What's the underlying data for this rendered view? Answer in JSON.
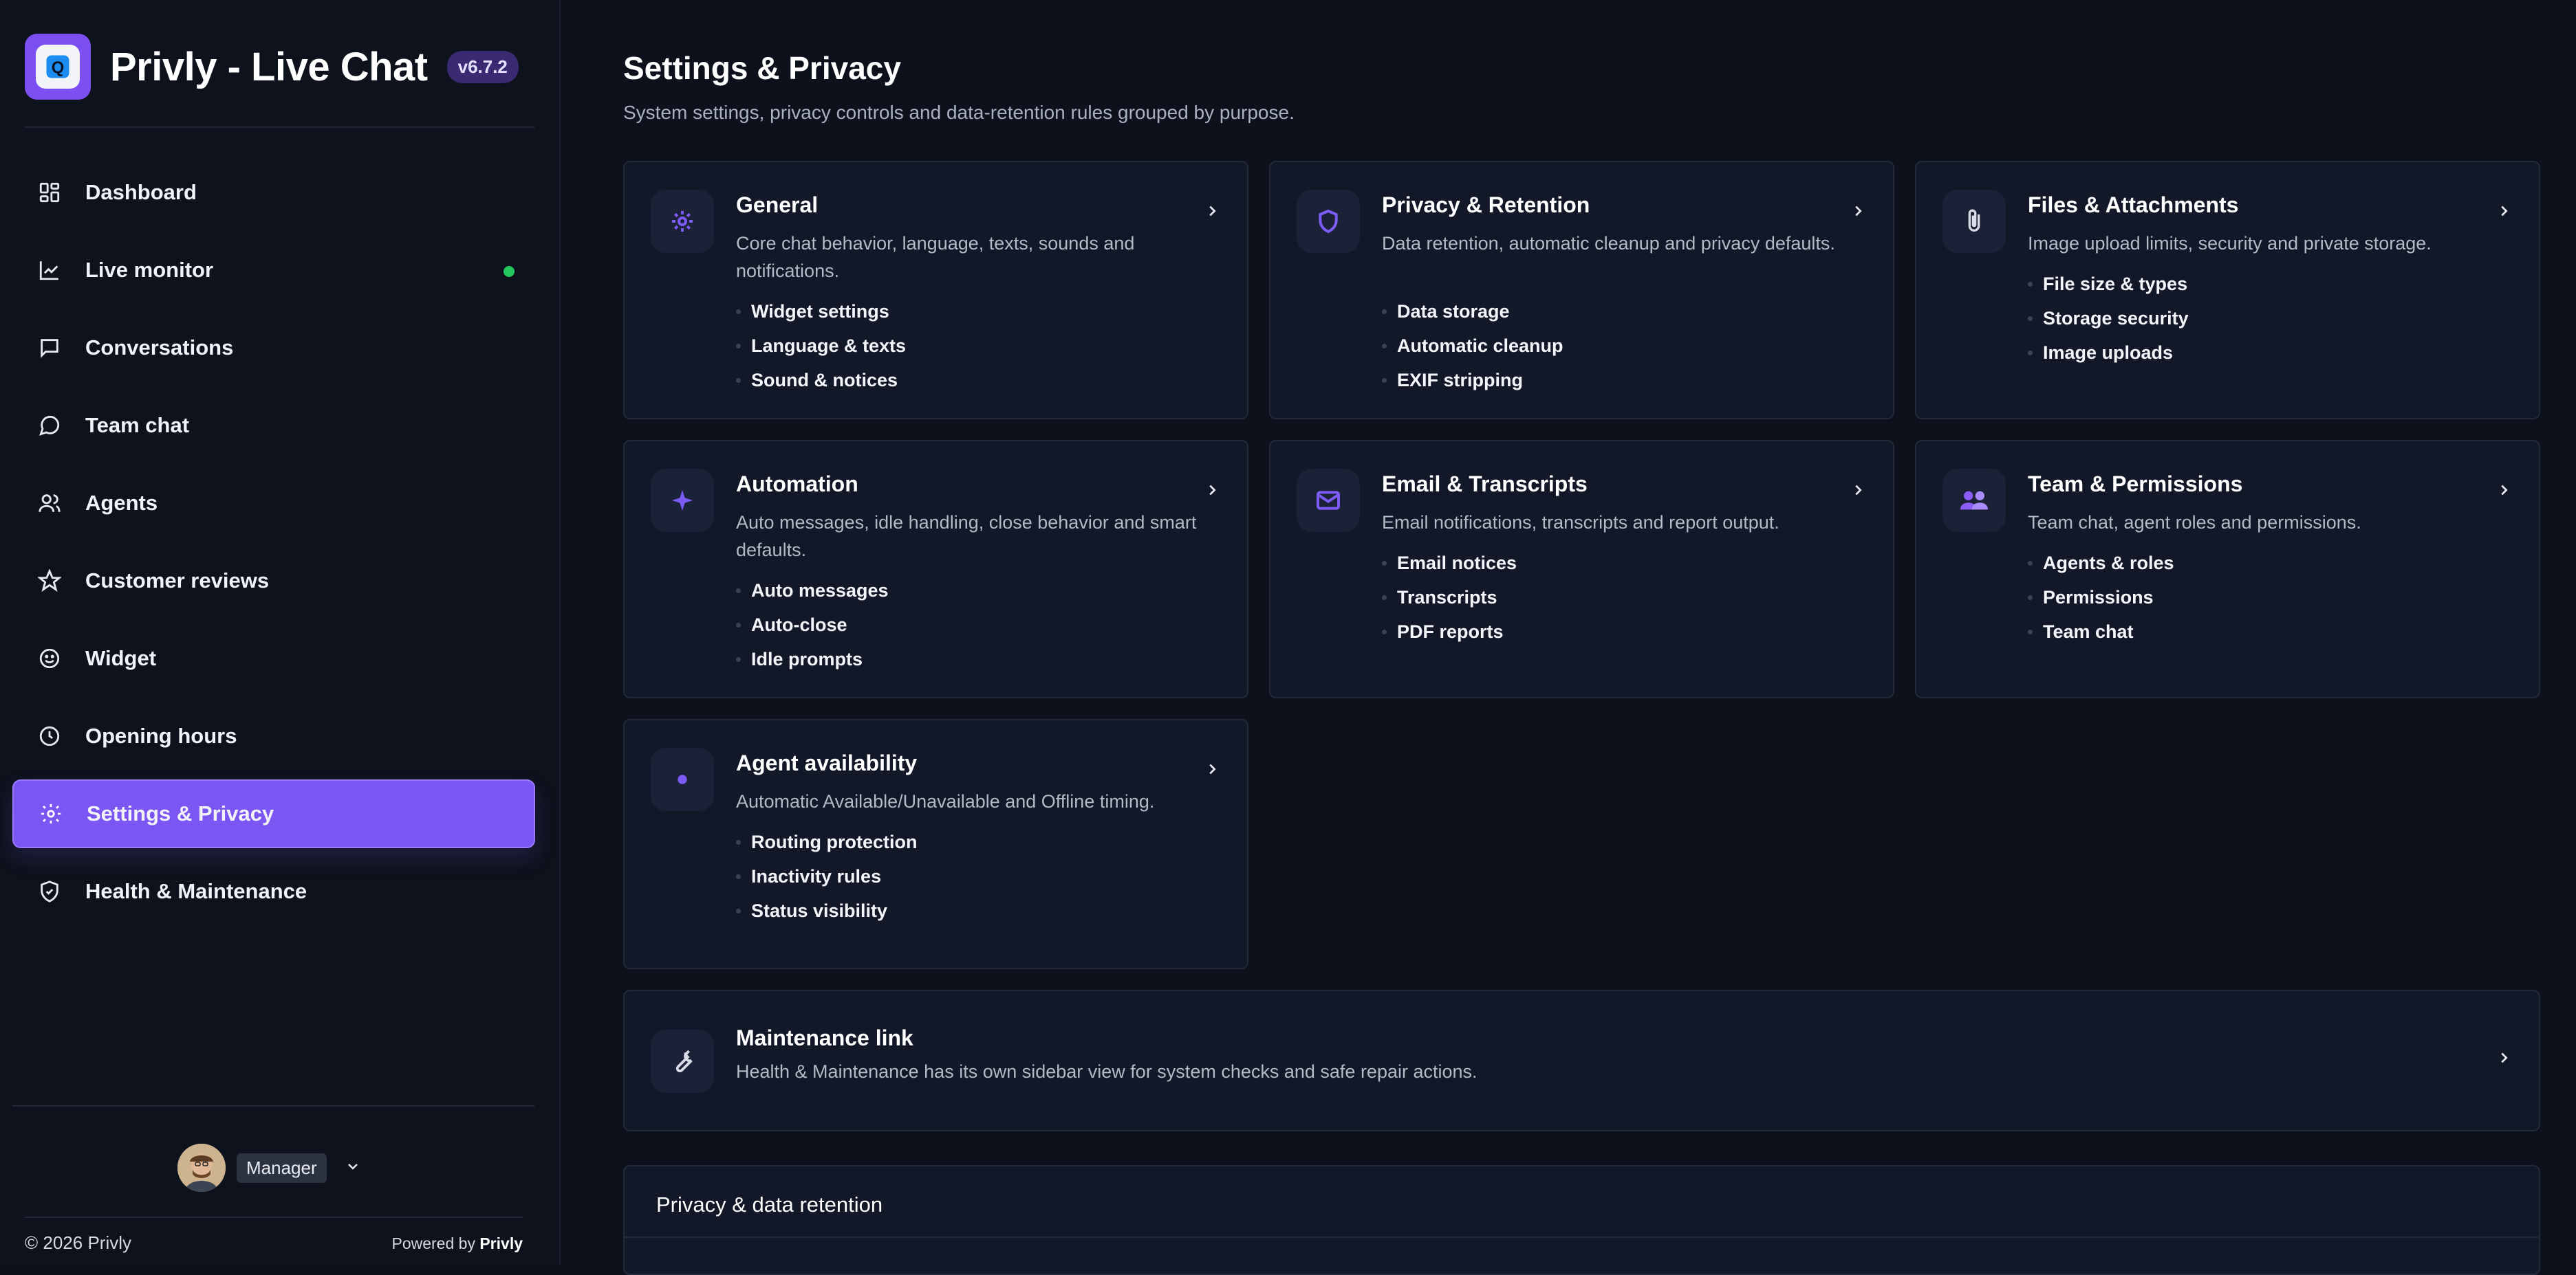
{
  "app": {
    "title": "Privly - Live Chat",
    "version": "v6.7.2"
  },
  "sidebar": {
    "items": [
      {
        "label": "Dashboard",
        "icon": "dashboard-icon"
      },
      {
        "label": "Live monitor",
        "icon": "chart-line-icon",
        "status": "online"
      },
      {
        "label": "Conversations",
        "icon": "chat-bubble-icon"
      },
      {
        "label": "Team chat",
        "icon": "chat-round-icon"
      },
      {
        "label": "Agents",
        "icon": "users-icon"
      },
      {
        "label": "Customer reviews",
        "icon": "star-icon"
      },
      {
        "label": "Widget",
        "icon": "smile-icon"
      },
      {
        "label": "Opening hours",
        "icon": "clock-icon"
      },
      {
        "label": "Settings & Privacy",
        "icon": "gear-icon",
        "active": true
      },
      {
        "label": "Health & Maintenance",
        "icon": "shield-check-icon"
      }
    ],
    "user": {
      "role": "Manager"
    },
    "footer": {
      "copyright": "© 2026 Privly",
      "powered_prefix": "Powered by",
      "powered_brand": "Privly"
    }
  },
  "page": {
    "title": "Settings & Privacy",
    "subtitle": "System settings, privacy controls and data-retention rules grouped by purpose."
  },
  "cards": [
    {
      "title": "General",
      "icon": "gear-icon",
      "desc": "Core chat behavior, language, texts, sounds and notifications.",
      "items": [
        "Widget settings",
        "Language & texts",
        "Sound & notices"
      ]
    },
    {
      "title": "Privacy & Retention",
      "icon": "shield-icon",
      "desc": "Data retention, automatic cleanup and privacy defaults.",
      "items": [
        "Data storage",
        "Automatic cleanup",
        "EXIF stripping"
      ]
    },
    {
      "title": "Files & Attachments",
      "icon": "paperclip-icon",
      "desc": "Image upload limits, security and private storage.",
      "items": [
        "File size & types",
        "Storage security",
        "Image uploads"
      ]
    },
    {
      "title": "Automation",
      "icon": "sparkle-icon",
      "desc": "Auto messages, idle handling, close behavior and smart defaults.",
      "items": [
        "Auto messages",
        "Auto-close",
        "Idle prompts"
      ]
    },
    {
      "title": "Email & Transcripts",
      "icon": "mail-icon",
      "desc": "Email notifications, transcripts and report output.",
      "items": [
        "Email notices",
        "Transcripts",
        "PDF reports"
      ]
    },
    {
      "title": "Team & Permissions",
      "icon": "team-icon",
      "desc": "Team chat, agent roles and permissions.",
      "items": [
        "Agents & roles",
        "Permissions",
        "Team chat"
      ]
    },
    {
      "title": "Agent availability",
      "icon": "dot-icon",
      "desc": "Automatic Available/Unavailable and Offline timing.",
      "items": [
        "Routing protection",
        "Inactivity rules",
        "Status visibility"
      ]
    }
  ],
  "maintenance": {
    "title": "Maintenance link",
    "icon": "wrench-icon",
    "desc": "Health & Maintenance has its own sidebar view for system checks and safe repair actions."
  },
  "section": {
    "title": "Privacy & data retention"
  },
  "colors": {
    "accent": "#7c56f2",
    "background": "#0c111b",
    "card": "#121828",
    "online": "#22c55e"
  }
}
